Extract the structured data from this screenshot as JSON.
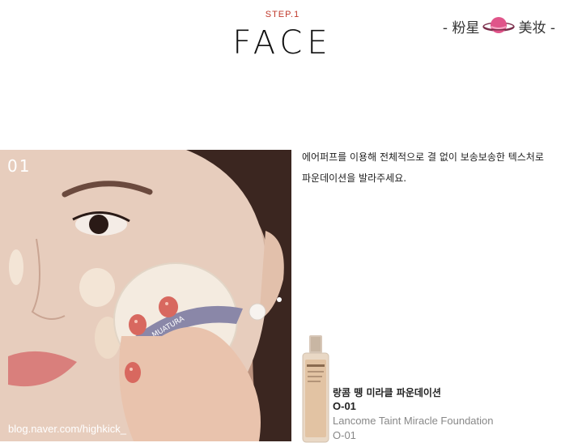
{
  "header": {
    "step": "STEP.1",
    "title": "FACE",
    "brand_left": "- 粉星",
    "brand_right": "美妆 -"
  },
  "photo": {
    "number": "01",
    "credit": "blog.naver.com/highkick_",
    "puff_brand": "MUATURA"
  },
  "description": {
    "line1": "에어퍼프를 이용해 전체적으로 결 없이 보송보송한 텍스처로",
    "line2": "파운데이션을 발라주세요."
  },
  "product": {
    "korean_name": "랑콤 뗑 미라클 파운데이션",
    "korean_code": "O-01",
    "english_name": "Lancome Taint Miracle Foundation",
    "english_code": "O-01"
  },
  "colors": {
    "accent": "#c0392b",
    "planet": "#e0558a",
    "muted_text": "#888888"
  }
}
